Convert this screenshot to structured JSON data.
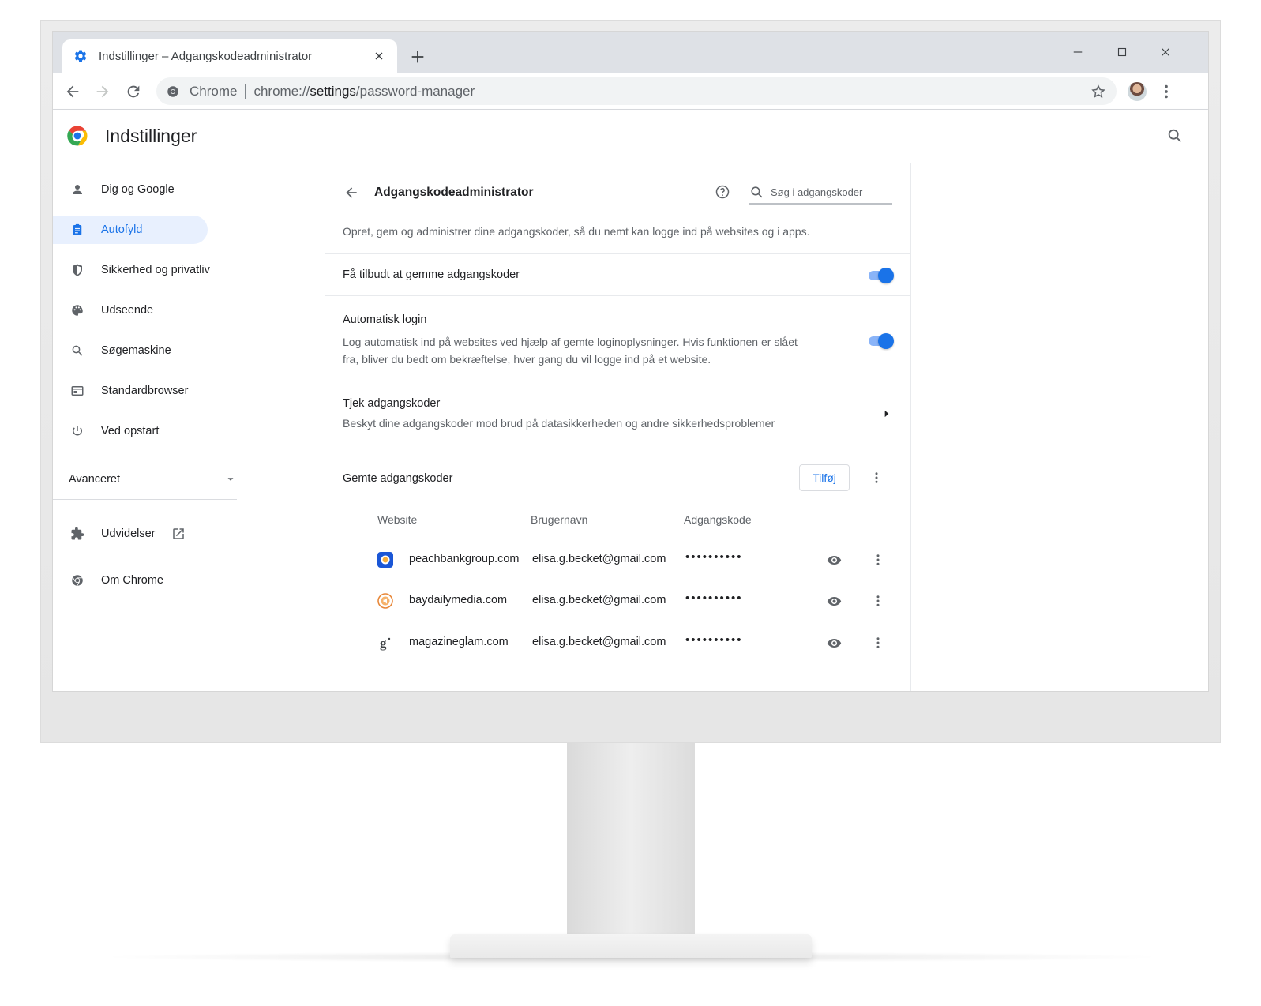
{
  "colors": {
    "accent": "#1a73e8",
    "accent_light": "#8ab4f8",
    "active_nav_bg": "#e8f0fe",
    "tabstrip_bg": "#dee1e6",
    "text_primary": "#202124",
    "text_secondary": "#5f6368"
  },
  "browser": {
    "tab": {
      "title": "Indstillinger – Adgangskodeadministrator",
      "favicon": "gear-icon"
    },
    "omnibox": {
      "site_label": "Chrome",
      "url_prefix": "chrome://",
      "url_host": "settings",
      "url_path": "/password-manager"
    }
  },
  "settings": {
    "title": "Indstillinger"
  },
  "sidebar": {
    "items": [
      {
        "label": "Dig og Google",
        "icon": "person-icon",
        "active": false
      },
      {
        "label": "Autofyld",
        "icon": "clipboard-icon",
        "active": true
      },
      {
        "label": "Sikkerhed og privatliv",
        "icon": "shield-icon",
        "active": false
      },
      {
        "label": "Udseende",
        "icon": "palette-icon",
        "active": false
      },
      {
        "label": "Søgemaskine",
        "icon": "search-icon",
        "active": false
      },
      {
        "label": "Standardbrowser",
        "icon": "browser-window-icon",
        "active": false
      },
      {
        "label": "Ved opstart",
        "icon": "power-icon",
        "active": false
      }
    ],
    "advanced_label": "Avanceret",
    "extensions_label": "Udvidelser",
    "about_label": "Om Chrome"
  },
  "password_manager": {
    "title": "Adgangskodeadministrator",
    "search_placeholder": "Søg i adgangskoder",
    "description": "Opret, gem og administrer dine adgangskoder, så du nemt kan logge ind på websites og i apps.",
    "offer_to_save": {
      "label": "Få tilbudt at gemme adgangskoder",
      "enabled": true
    },
    "auto_signin": {
      "label": "Automatisk login",
      "description_line1": "Log automatisk ind på websites ved hjælp af gemte loginoplysninger. Hvis funktionen er slået",
      "description_line2": "fra, bliver du bedt om bekræftelse, hver gang du vil logge ind på et website.",
      "enabled": true
    },
    "check_passwords": {
      "label": "Tjek adgangskoder",
      "description": "Beskyt dine adgangskoder mod brud på datasikkerheden og andre sikkerhedsproblemer"
    },
    "saved": {
      "label": "Gemte adgangskoder",
      "add_button": "Tilføj",
      "columns": [
        "Website",
        "Brugernavn",
        "Adgangskode"
      ],
      "rows": [
        {
          "site": "peachbankgroup.com",
          "username": "elisa.g.becket@gmail.com",
          "password": "••••••••••",
          "icon": "peachbank-logo-icon"
        },
        {
          "site": "baydailymedia.com",
          "username": "elisa.g.becket@gmail.com",
          "password": "••••••••••",
          "icon": "baydailymedia-logo-icon"
        },
        {
          "site": "magazineglam.com",
          "username": "elisa.g.becket@gmail.com",
          "password": "••••••••••",
          "icon": "magazineglam-logo-icon"
        }
      ]
    }
  }
}
